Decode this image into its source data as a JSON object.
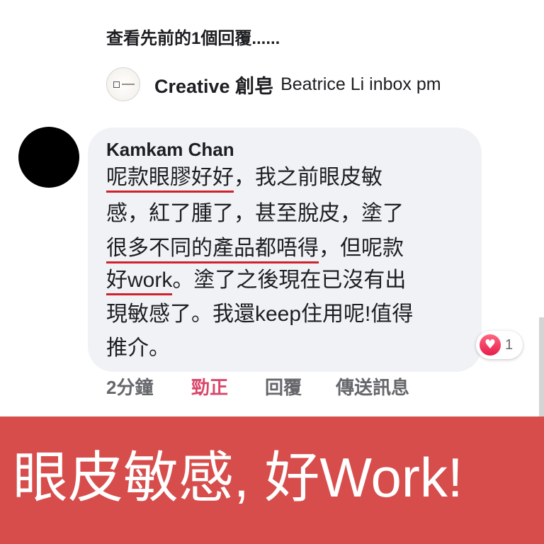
{
  "colors": {
    "bubble_background": "#f0f2f5",
    "like_active": "#d9476b",
    "underline": "#d0212d",
    "banner_background": "#d74d4c",
    "banner_text": "#ffffff",
    "muted_text": "#65676b"
  },
  "thread": {
    "view_previous": "查看先前的1個回覆......",
    "reply_preview": {
      "author": "Creative 創皂",
      "text": "Beatrice Li inbox pm",
      "avatar_icon": "creative-logo-icon"
    }
  },
  "comment": {
    "avatar_icon": "commenter-avatar",
    "author": "Kamkam Chan",
    "body": {
      "line1_marked": "呢款眼膠好好",
      "line1_rest": "，我之前眼皮敏",
      "line2": "感，紅了腫了，甚至脫皮，塗了",
      "line3_marked": "很多不同的產品都唔得",
      "line3_rest": "，但呢款",
      "line4_marked": "好work",
      "line4_rest": "。塗了之後現在已沒有出",
      "line5": "現敏感了。我還keep住用呢!值得",
      "line6": "推介。"
    },
    "reaction": {
      "icon": "heart-icon",
      "glyph": "♥",
      "count": "1"
    },
    "actions": {
      "time": "2分鐘",
      "like": "勁正",
      "reply": "回覆",
      "send_message": "傳送訊息"
    }
  },
  "banner": {
    "text": "眼皮敏感, 好Work!"
  }
}
